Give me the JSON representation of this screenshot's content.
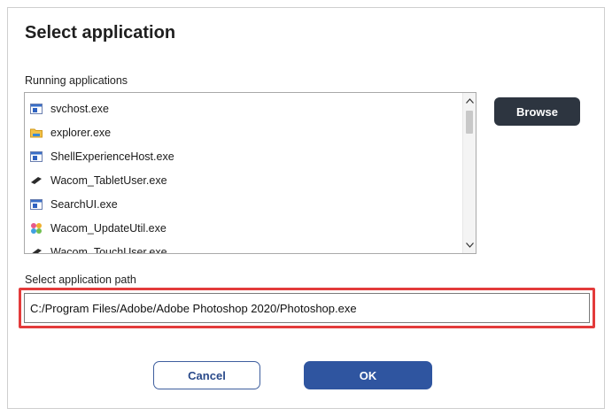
{
  "dialog": {
    "title": "Select application",
    "running_label": "Running applications",
    "browse_label": "Browse",
    "path_label": "Select application path",
    "path_value": "C:/Program Files/Adobe/Adobe Photoshop 2020/Photoshop.exe",
    "cancel_label": "Cancel",
    "ok_label": "OK"
  },
  "running_apps": [
    {
      "name": "svchost.exe",
      "icon": "window-app-icon"
    },
    {
      "name": "explorer.exe",
      "icon": "folder-icon"
    },
    {
      "name": "ShellExperienceHost.exe",
      "icon": "window-app-icon"
    },
    {
      "name": "Wacom_TabletUser.exe",
      "icon": "wacom-pen-icon"
    },
    {
      "name": "SearchUI.exe",
      "icon": "window-app-icon"
    },
    {
      "name": "Wacom_UpdateUtil.exe",
      "icon": "wacom-update-icon"
    },
    {
      "name": "Wacom_TouchUser.exe",
      "icon": "wacom-pen-icon"
    }
  ],
  "colors": {
    "browse_bg": "#2d3540",
    "ok_bg": "#2f55a0",
    "cancel_border": "#3e5e9e",
    "highlight": "#e33b3b"
  }
}
